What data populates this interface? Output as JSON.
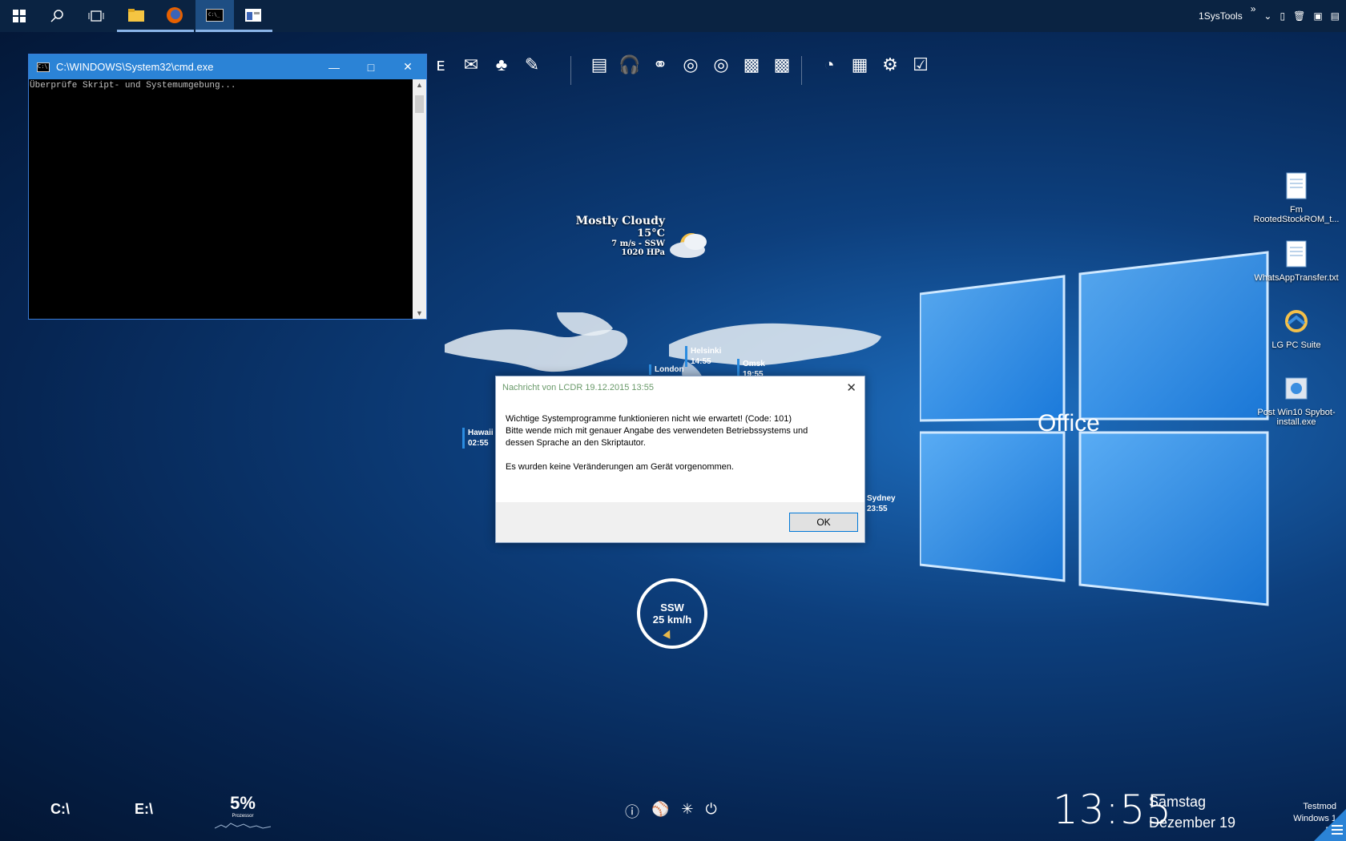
{
  "taskbar": {
    "buttons": [
      {
        "name": "start-button",
        "icon": "windows-icon"
      },
      {
        "name": "search-button",
        "icon": "search-icon"
      },
      {
        "name": "task-view-button",
        "icon": "task-view-icon"
      },
      {
        "name": "file-explorer-button",
        "icon": "folder-icon"
      },
      {
        "name": "firefox-button",
        "icon": "firefox-icon"
      },
      {
        "name": "cmd-button",
        "icon": "cmd-icon"
      },
      {
        "name": "app-button",
        "icon": "window-icon"
      }
    ],
    "toolbar_label": "1SysTools",
    "overflow": "»"
  },
  "cmd_window": {
    "title": "C:\\WINDOWS\\System32\\cmd.exe",
    "icon_text": "C:\\",
    "output": "Überprüfe Skript- und Systemumgebung..."
  },
  "weather": {
    "condition": "Mostly Cloudy",
    "temperature": "15°C",
    "wind": "7 m/s - SSW",
    "pressure": "1020 HPa"
  },
  "world_clock": {
    "cities": [
      {
        "name": "Helsinki",
        "time": "14:55"
      },
      {
        "name": "London",
        "time": ""
      },
      {
        "name": "Omsk",
        "time": "19:55"
      },
      {
        "name": "Hawaii",
        "time": "02:55"
      },
      {
        "name": "Sydney",
        "time": "23:55"
      }
    ]
  },
  "dialog": {
    "title": "Nachricht von LCDR 19.12.2015 13:55",
    "line1": "Wichtige Systemprogramme funktionieren nicht wie erwartet! (Code: 101)",
    "line2": "Bitte wende mich mit genauer Angabe des verwendeten Betriebssystems und",
    "line3": "dessen Sprache an den Skriptautor.",
    "line4": "Es wurden keine Veränderungen am Gerät vorgenommen.",
    "ok_label": "OK"
  },
  "wind_gauge": {
    "direction": "SSW",
    "speed": "25 km/h"
  },
  "desktop_icons": [
    {
      "label": "Fm RootedStockROM_t...",
      "icon": "text-file-icon"
    },
    {
      "label": "WhatsAppTransfer.txt",
      "icon": "text-file-icon"
    },
    {
      "label": "LG PC Suite",
      "icon": "lg-pc-suite-icon"
    },
    {
      "label": "Post Win10 Spybot-install.exe",
      "icon": "installer-icon"
    }
  ],
  "office_logo": "Office",
  "bottom": {
    "drive_c": "C:\\",
    "drive_e": "E:\\",
    "cpu_percent": "5%",
    "cpu_label": "Prozessor",
    "time": "13:55",
    "weekday": "Samstag",
    "date": "Dezember 19",
    "testmode_1": "Testmod",
    "testmode_2": "Windows 1",
    "testmode_3": "Bu"
  },
  "colors": {
    "accent": "#2b83d6",
    "taskbar": "#0a2342"
  }
}
